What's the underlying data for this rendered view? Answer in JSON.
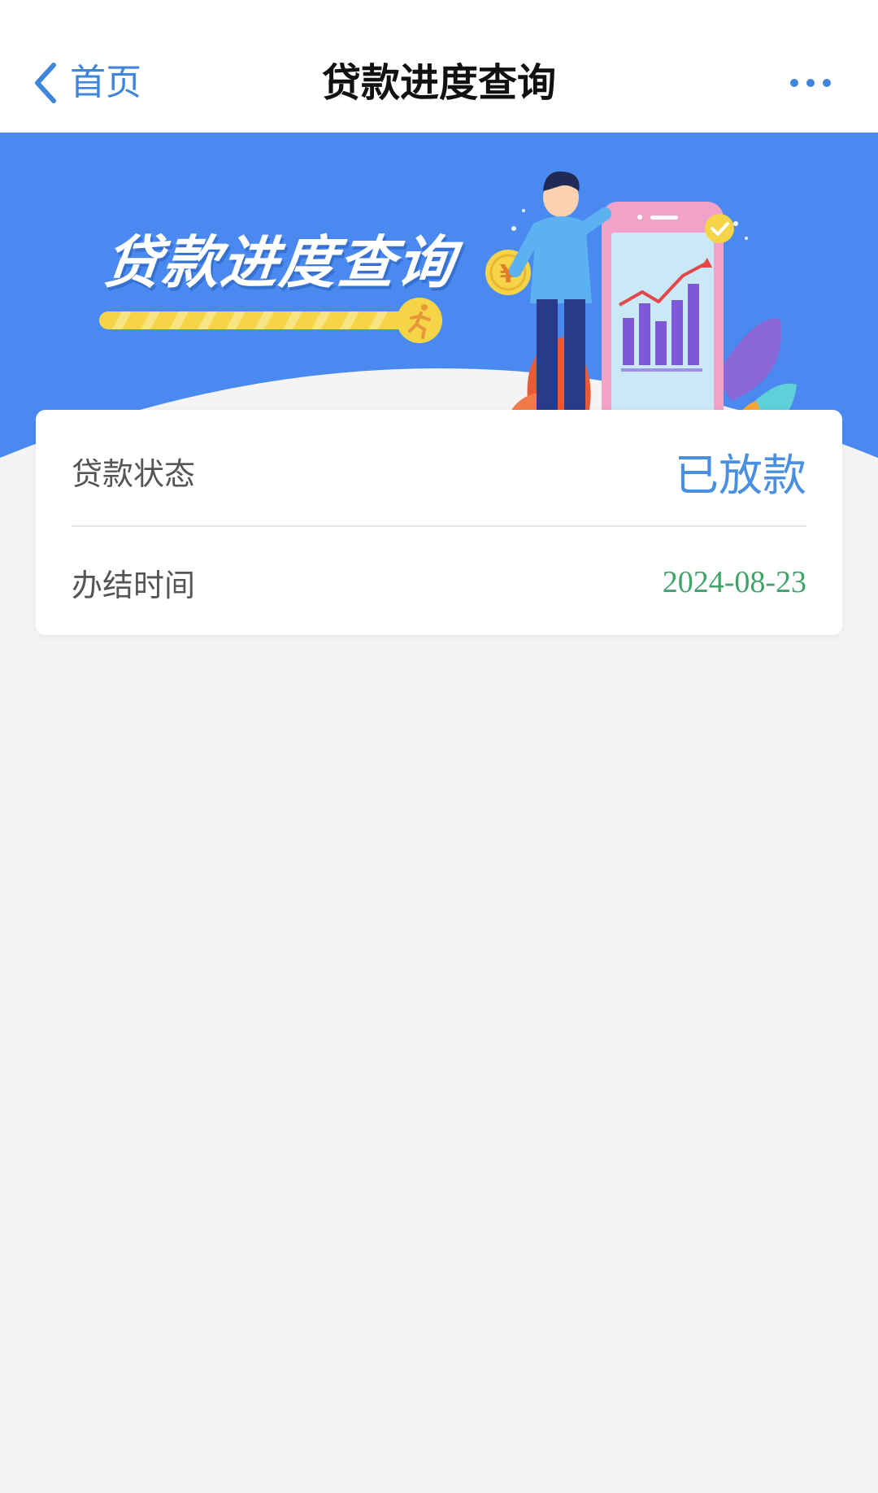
{
  "nav": {
    "back_label": "首页",
    "title": "贷款进度查询",
    "more_icon": "more-dots-icon"
  },
  "banner": {
    "title": "贷款进度查询",
    "background_color": "#4a8af0",
    "progress_bar_color": "#f5d547"
  },
  "loan": {
    "status_label": "贷款状态",
    "status_value": "已放款",
    "date_label": "办结时间",
    "date_value": "2024-08-23"
  },
  "colors": {
    "accent": "#3d86dc",
    "status": "#4a8fe0",
    "date": "#3fa36a"
  }
}
